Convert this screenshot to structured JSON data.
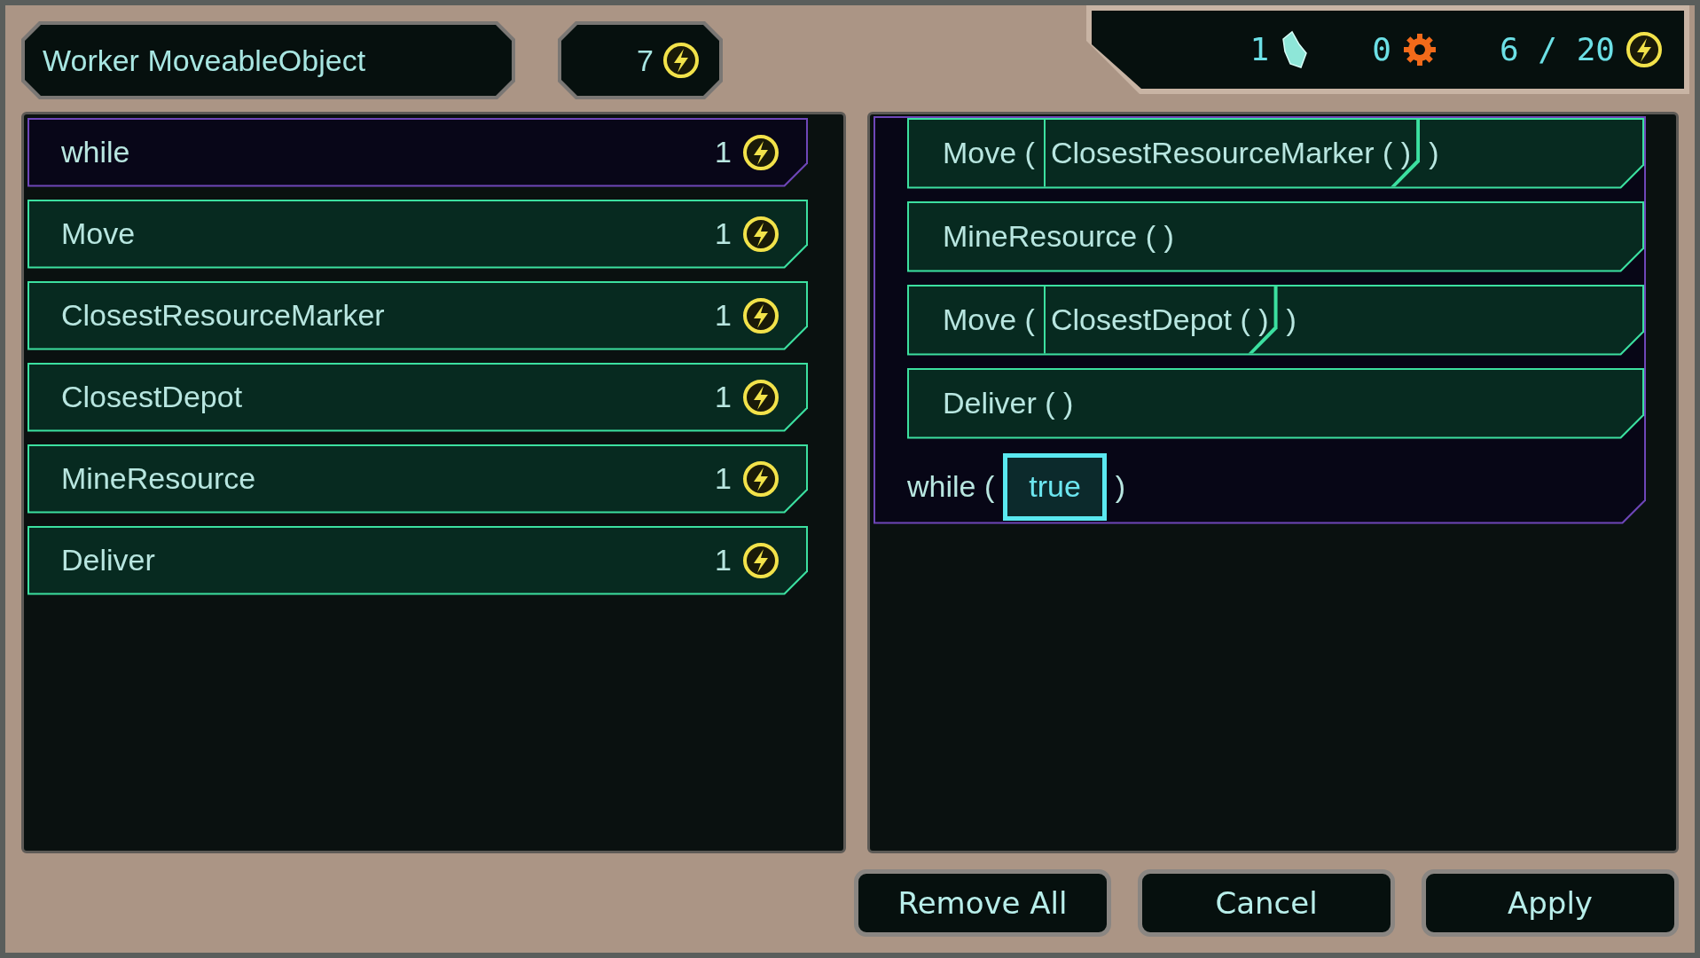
{
  "header": {
    "title": "Worker MoveableObject",
    "cost": "7"
  },
  "resources": [
    {
      "kind": "crystal",
      "value": "1"
    },
    {
      "kind": "gear",
      "value": "0"
    },
    {
      "kind": "energy",
      "value": "6 / 20"
    }
  ],
  "palette": [
    {
      "kind": "control",
      "label": "while",
      "cost": "1"
    },
    {
      "kind": "action",
      "label": "Move",
      "cost": "1"
    },
    {
      "kind": "action",
      "label": "ClosestResourceMarker",
      "cost": "1"
    },
    {
      "kind": "action",
      "label": "ClosestDepot",
      "cost": "1"
    },
    {
      "kind": "action",
      "label": "MineResource",
      "cost": "1"
    },
    {
      "kind": "action",
      "label": "Deliver",
      "cost": "1"
    }
  ],
  "program": {
    "statements": [
      {
        "head": "Move (",
        "arg": "ClosestResourceMarker ( )",
        "tail": ")"
      },
      {
        "head": "MineResource ( )"
      },
      {
        "head": "Move (",
        "arg": "ClosestDepot ( )",
        "tail": ")"
      },
      {
        "head": "Deliver ( )"
      }
    ],
    "loop": {
      "keyword": "while (",
      "condition": {
        "text": "true",
        "selected": true
      },
      "close": ")"
    }
  },
  "buttons": [
    "Remove All",
    "Cancel",
    "Apply"
  ]
}
